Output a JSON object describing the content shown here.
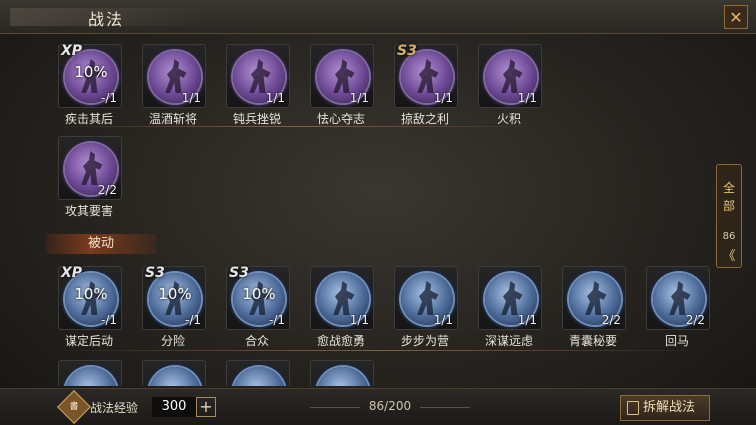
{
  "window": {
    "title": "战法",
    "close_glyph": "✕"
  },
  "active_skills": [
    {
      "name": "疾击其后",
      "badge": "XP",
      "percent": "10%",
      "count": "-/1",
      "theme": "purple"
    },
    {
      "name": "温酒斩将",
      "badge": "",
      "percent": "",
      "count": "1/1",
      "theme": "purple"
    },
    {
      "name": "钝兵挫锐",
      "badge": "",
      "percent": "",
      "count": "1/1",
      "theme": "purple"
    },
    {
      "name": "怯心夺志",
      "badge": "",
      "percent": "",
      "count": "1/1",
      "theme": "purple"
    },
    {
      "name": "掠敌之利",
      "badge": "S3",
      "percent": "",
      "count": "1/1",
      "theme": "purple"
    },
    {
      "name": "火积",
      "badge": "",
      "percent": "",
      "count": "1/1",
      "theme": "purple"
    },
    {
      "name": "攻其要害",
      "badge": "",
      "percent": "",
      "count": "2/2",
      "theme": "purple"
    }
  ],
  "passive_section": {
    "label": "被动"
  },
  "passive_skills": [
    {
      "name": "谋定后动",
      "badge": "XP",
      "percent": "10%",
      "count": "-/1",
      "theme": "blue"
    },
    {
      "name": "分险",
      "badge": "S3",
      "percent": "10%",
      "count": "-/1",
      "theme": "blue"
    },
    {
      "name": "合众",
      "badge": "S3",
      "percent": "10%",
      "count": "-/1",
      "theme": "blue"
    },
    {
      "name": "愈战愈勇",
      "badge": "",
      "percent": "",
      "count": "1/1",
      "theme": "blue"
    },
    {
      "name": "步步为营",
      "badge": "",
      "percent": "",
      "count": "1/1",
      "theme": "blue"
    },
    {
      "name": "深谋远虑",
      "badge": "",
      "percent": "",
      "count": "1/1",
      "theme": "blue"
    },
    {
      "name": "青囊秘要",
      "badge": "",
      "percent": "",
      "count": "2/2",
      "theme": "blue"
    },
    {
      "name": "回马",
      "badge": "",
      "percent": "",
      "count": "2/2",
      "theme": "blue"
    }
  ],
  "side_tab": {
    "label_line1": "全",
    "label_line2": "部",
    "count": "86",
    "arrow": "《"
  },
  "footer": {
    "exp_label": "战法经验",
    "exp_value": "300",
    "plus_glyph": "+",
    "capacity": "86/200",
    "dismantle_label": "拆解战法"
  }
}
